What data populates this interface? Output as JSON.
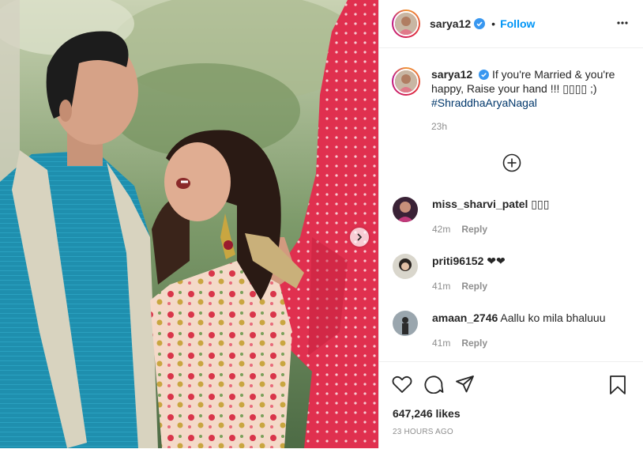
{
  "post": {
    "username": "sarya12",
    "follow_label": "Follow",
    "dot": "•"
  },
  "caption": {
    "username": "sarya12",
    "text": "If you're Married & you're happy, Raise your hand !!! ▯▯▯▯ ;)",
    "hashtag": "#ShraddhaAryaNagal",
    "time": "23h"
  },
  "comments": [
    {
      "username": "miss_sharvi_patel",
      "text": "▯▯▯",
      "time": "42m",
      "reply": "Reply"
    },
    {
      "username": "priti96152",
      "text": "❤❤",
      "time": "41m",
      "reply": "Reply"
    },
    {
      "username": "amaan_2746",
      "text": "Aallu ko mila bhaluuu",
      "time": "41m",
      "reply": "Reply"
    }
  ],
  "footer": {
    "likes": "647,246 likes",
    "posted_ago": "23 HOURS AGO"
  },
  "icons": [
    "verified-badge-icon",
    "more-options-icon",
    "load-more-comments-icon",
    "heart-icon",
    "comment-icon",
    "share-icon",
    "bookmark-icon",
    "chevron-right-icon"
  ],
  "colors": {
    "accent": "#0095f6",
    "hashtag": "#00376b",
    "muted": "#8e8e8e",
    "border": "#efefef"
  }
}
